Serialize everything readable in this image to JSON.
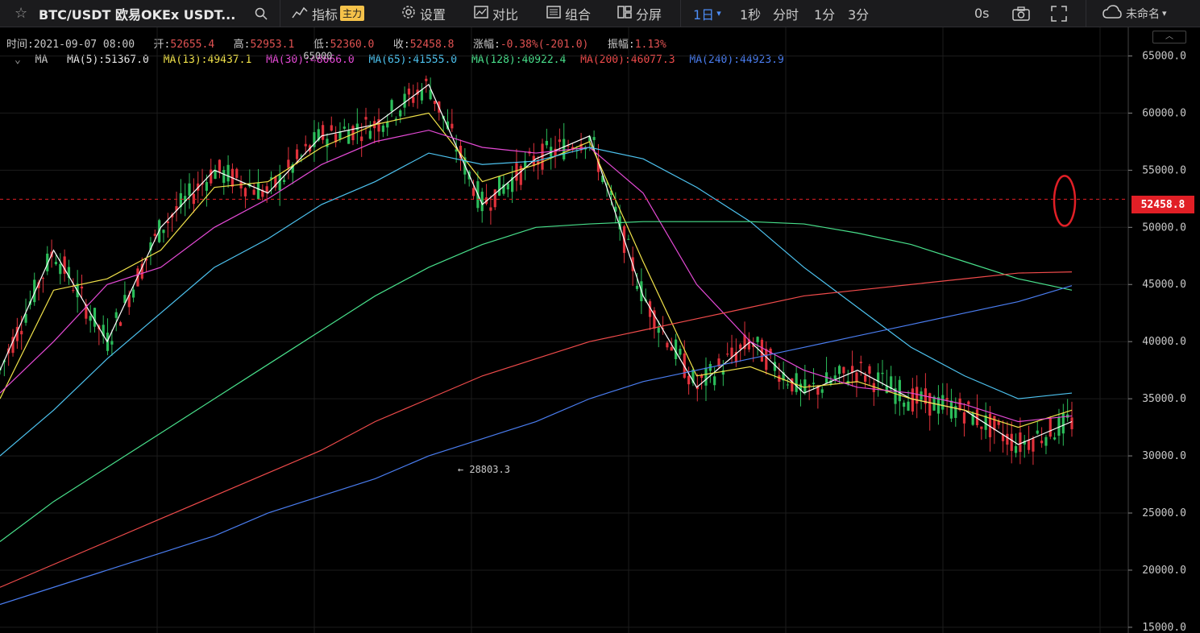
{
  "toolbar": {
    "symbol": "BTC/USDT 欧易OKEx USDT...",
    "indicators_label": "指标",
    "indicators_badge": "主力",
    "settings_label": "设置",
    "compare_label": "对比",
    "combine_label": "组合",
    "split_label": "分屏",
    "intervals": [
      "1日",
      "1秒",
      "分时",
      "1分",
      "3分"
    ],
    "delay": "0s",
    "cloud_label": "未命名"
  },
  "info": {
    "time_label": "时间:",
    "time": "2021-09-07 08:00",
    "open_label": "开:",
    "open": "52655.4",
    "high_label": "高:",
    "high": "52953.1",
    "low_label": "低:",
    "low": "52360.0",
    "close_label": "收:",
    "close": "52458.8",
    "change_label": "涨幅:",
    "change": "-0.38%(-201.0)",
    "amp_label": "振幅:",
    "amp": "1.13%"
  },
  "ma_row": {
    "label": "MA",
    "items": [
      {
        "text": "MA(5):51367.0",
        "color": "#e8e8e8"
      },
      {
        "text": "MA(13):49437.1",
        "color": "#f2e34a"
      },
      {
        "text": "MA(30):48066.0",
        "color": "#e54ad6"
      },
      {
        "text": "MA(65):41555.0",
        "color": "#4dc3f0"
      },
      {
        "text": "MA(128):40922.4",
        "color": "#48e08b"
      },
      {
        "text": "MA(200):46077.3",
        "color": "#f04b4b"
      },
      {
        "text": "MA(240):44923.9",
        "color": "#4a7df0"
      }
    ]
  },
  "chart_data": {
    "type": "line",
    "title": "BTC/USDT 欧易OKEx USDT",
    "ylim": [
      14500,
      67500
    ],
    "yticks": [
      "65000.0",
      "60000.0",
      "55000.0",
      "50000.0",
      "45000.0",
      "40000.0",
      "35000.0",
      "30000.0",
      "25000.0",
      "20000.0",
      "15000.0"
    ],
    "last_price": "52458.8",
    "annotations": [
      {
        "text": "← 28803.3",
        "x": 0.424,
        "value": 28803.3
      },
      {
        "text": "65000",
        "x": 0.28,
        "value": 65000
      }
    ],
    "colors": {
      "up": "#2bbd5a",
      "down": "#e0313b"
    },
    "x": [
      0,
      0.05,
      0.1,
      0.15,
      0.2,
      0.25,
      0.3,
      0.35,
      0.4,
      0.45,
      0.5,
      0.55,
      0.6,
      0.65,
      0.7,
      0.75,
      0.8,
      0.85,
      0.9,
      0.95,
      1.0
    ],
    "series": [
      {
        "name": "MA(5)",
        "color": "#ffffff",
        "values": [
          37500,
          48000,
          40000,
          50000,
          55000,
          53000,
          58000,
          59000,
          62500,
          52000,
          56000,
          58000,
          44000,
          36000,
          40000,
          35500,
          37500,
          35000,
          34000,
          31000,
          33000
        ]
      },
      {
        "name": "MA(13)",
        "color": "#f2e34a",
        "values": [
          35000,
          44500,
          45500,
          48000,
          53500,
          54000,
          57000,
          59000,
          60000,
          54000,
          55500,
          57500,
          47000,
          37000,
          37800,
          36000,
          36500,
          35000,
          34000,
          32500,
          34000
        ]
      },
      {
        "name": "MA(30)",
        "color": "#e54ad6",
        "values": [
          35500,
          40000,
          45000,
          46500,
          50000,
          52500,
          55500,
          57500,
          58500,
          57000,
          56500,
          57000,
          53000,
          45000,
          40000,
          37500,
          36000,
          35500,
          34500,
          33000,
          33500
        ]
      },
      {
        "name": "MA(65)",
        "color": "#4dc3f0",
        "values": [
          30000,
          34000,
          38500,
          42500,
          46500,
          49000,
          52000,
          54000,
          56500,
          55500,
          55800,
          57000,
          56000,
          53500,
          50500,
          46500,
          43000,
          39500,
          37000,
          35000,
          35500
        ]
      },
      {
        "name": "MA(128)",
        "color": "#48e08b",
        "values": [
          22500,
          26000,
          29000,
          32000,
          35000,
          38000,
          41000,
          44000,
          46500,
          48500,
          50000,
          50300,
          50500,
          50500,
          50500,
          50300,
          49500,
          48500,
          47000,
          45500,
          44500
        ]
      },
      {
        "name": "MA(200)",
        "color": "#f04b4b",
        "values": [
          18500,
          20500,
          22500,
          24500,
          26500,
          28500,
          30500,
          33000,
          35000,
          37000,
          38500,
          40000,
          41000,
          42000,
          43000,
          44000,
          44500,
          45000,
          45500,
          46000,
          46100
        ]
      },
      {
        "name": "MA(240)",
        "color": "#4a7df0",
        "values": [
          17000,
          18500,
          20000,
          21500,
          23000,
          25000,
          26500,
          28000,
          30000,
          31500,
          33000,
          35000,
          36500,
          37500,
          38500,
          39500,
          40500,
          41500,
          42500,
          43500,
          44900
        ]
      }
    ]
  }
}
